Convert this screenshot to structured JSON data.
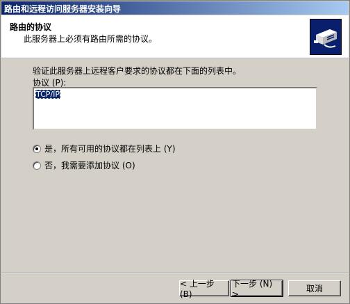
{
  "window": {
    "title": "路由和远程访问服务器安装向导"
  },
  "header": {
    "title": "路由的协议",
    "subtitle": "此服务器上必须有路由所需的协议。",
    "icon": "network-device-icon"
  },
  "body": {
    "description": "验证此服务器上远程客户要求的协议都在下面的列表中。",
    "list_label": "协议 (P):",
    "protocols": [
      "TCP/IP"
    ],
    "options": [
      {
        "label": "是，所有可用的协议都在列表上 (Y)",
        "checked": true
      },
      {
        "label": "否，我需要添加协议 (O)",
        "checked": false
      }
    ]
  },
  "buttons": {
    "back": "< 上一步 (B)",
    "next": "下一步 (N) >",
    "cancel": "取消"
  }
}
